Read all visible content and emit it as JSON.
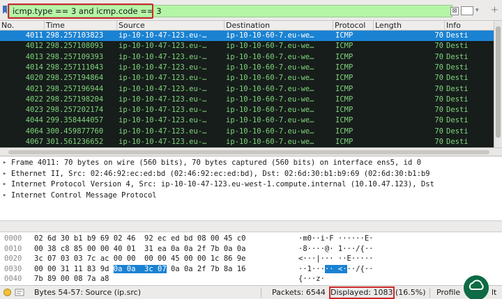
{
  "filter": {
    "value": "icmp.type == 3 and icmp.code == 3",
    "clear_glyph": "⊠",
    "plus_glyph": "+",
    "arrow_glyph": "▾"
  },
  "colors": {
    "filter_valid_bg": "#b5f5a6",
    "row_bg": "#171d1b",
    "row_fg": "#7fd47c",
    "selected_bg": "#1a82d3",
    "highlight_border": "#cc2a2a",
    "status_led": "#f1c232"
  },
  "packet_list": {
    "columns": [
      "No.",
      "Time",
      "Source",
      "Destination",
      "Protocol",
      "Length",
      "Info"
    ],
    "rows": [
      {
        "no": "4011",
        "time": "298.257103823",
        "src": "ip-10-10-47-123.eu-…",
        "dst": "ip-10-10-60-7.eu-we…",
        "proto": "ICMP",
        "len": "70",
        "info": "Desti",
        "selected": true
      },
      {
        "no": "4012",
        "time": "298.257108093",
        "src": "ip-10-10-47-123.eu-…",
        "dst": "ip-10-10-60-7.eu-we…",
        "proto": "ICMP",
        "len": "70",
        "info": "Desti"
      },
      {
        "no": "4013",
        "time": "298.257109393",
        "src": "ip-10-10-47-123.eu-…",
        "dst": "ip-10-10-60-7.eu-we…",
        "proto": "ICMP",
        "len": "70",
        "info": "Desti"
      },
      {
        "no": "4014",
        "time": "298.257111043",
        "src": "ip-10-10-47-123.eu-…",
        "dst": "ip-10-10-60-7.eu-we…",
        "proto": "ICMP",
        "len": "70",
        "info": "Desti"
      },
      {
        "no": "4020",
        "time": "298.257194864",
        "src": "ip-10-10-47-123.eu-…",
        "dst": "ip-10-10-60-7.eu-we…",
        "proto": "ICMP",
        "len": "70",
        "info": "Desti"
      },
      {
        "no": "4021",
        "time": "298.257196944",
        "src": "ip-10-10-47-123.eu-…",
        "dst": "ip-10-10-60-7.eu-we…",
        "proto": "ICMP",
        "len": "70",
        "info": "Desti"
      },
      {
        "no": "4022",
        "time": "298.257198204",
        "src": "ip-10-10-47-123.eu-…",
        "dst": "ip-10-10-60-7.eu-we…",
        "proto": "ICMP",
        "len": "70",
        "info": "Desti"
      },
      {
        "no": "4023",
        "time": "298.257202174",
        "src": "ip-10-10-47-123.eu-…",
        "dst": "ip-10-10-60-7.eu-we…",
        "proto": "ICMP",
        "len": "70",
        "info": "Desti"
      },
      {
        "no": "4044",
        "time": "299.358444057",
        "src": "ip-10-10-47-123.eu-…",
        "dst": "ip-10-10-60-7.eu-we…",
        "proto": "ICMP",
        "len": "70",
        "info": "Desti"
      },
      {
        "no": "4064",
        "time": "300.459877760",
        "src": "ip-10-10-47-123.eu-…",
        "dst": "ip-10-10-60-7.eu-we…",
        "proto": "ICMP",
        "len": "70",
        "info": "Desti"
      },
      {
        "no": "4067",
        "time": "301.561236652",
        "src": "ip-10-10-47-123.eu-…",
        "dst": "ip-10-10-60-7.eu-we…",
        "proto": "ICMP",
        "len": "70",
        "info": "Desti"
      }
    ]
  },
  "details": [
    {
      "text": "Frame 4011: 70 bytes on wire (560 bits), 70 bytes captured (560 bits) on interface ens5, id 0"
    },
    {
      "text": "Ethernet II, Src: 02:46:92:ec:ed:bd (02:46:92:ec:ed:bd), Dst: 02:6d:30:b1:b9:69 (02:6d:30:b1:b9"
    },
    {
      "text": "Internet Protocol Version 4, Src: ip-10-10-47-123.eu-west-1.compute.internal (10.10.47.123), Dst"
    },
    {
      "text": "Internet Control Message Protocol"
    }
  ],
  "hex": [
    {
      "off": "0000",
      "pre": "02 6d 30 b1 b9 69 02 46  92 ec ed bd 08 00 45 c0",
      "hl": "",
      "post": "",
      "ascii_pre": "·m0··i·F ······E·",
      "ascii_hl": "",
      "ascii_post": ""
    },
    {
      "off": "0010",
      "pre": "00 38 c8 85 00 00 40 01  31 ea 0a 0a 2f 7b 0a 0a",
      "hl": "",
      "post": "",
      "ascii_pre": "·8····@· 1···/{··",
      "ascii_hl": "",
      "ascii_post": ""
    },
    {
      "off": "0020",
      "pre": "3c 07 03 03 7c ac 00 00  00 00 45 00 00 1c 86 9e",
      "hl": "",
      "post": "",
      "ascii_pre": "<···|··· ··E·····",
      "ascii_hl": "",
      "ascii_post": ""
    },
    {
      "off": "0030",
      "pre": "00 00 31 11 83 9d ",
      "hl": "0a 0a  3c 07",
      "post": " 0a 0a 2f 7b 8a 16",
      "ascii_pre": "··1···",
      "ascii_hl": "·· <·",
      "ascii_post": "··/{··"
    },
    {
      "off": "0040",
      "pre": "7b 89 00 08 7a a8",
      "hl": "",
      "post": "",
      "ascii_pre": "{···z·",
      "ascii_hl": "",
      "ascii_post": ""
    }
  ],
  "status": {
    "field": "Bytes 54-57: Source (ip.src)",
    "packets_label": "Packets: 6544",
    "displayed_label": "Displayed: 1083",
    "displayed_pct": "(16.5%)",
    "profile_label": "Profile",
    "profile_value": "lt"
  }
}
